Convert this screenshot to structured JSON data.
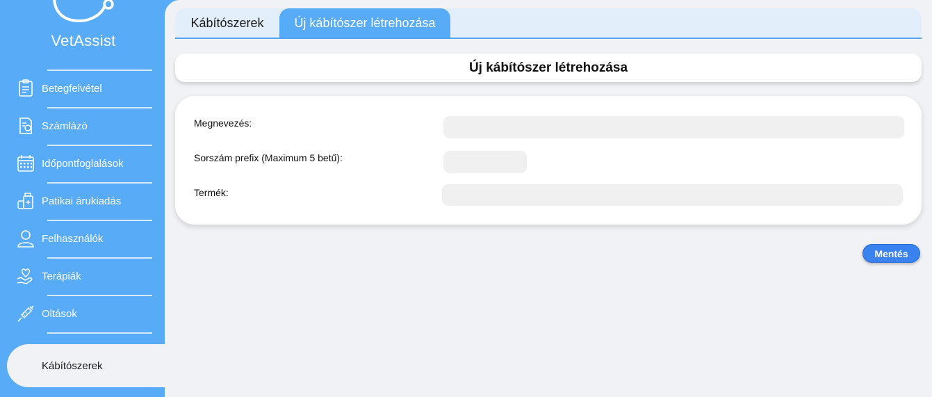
{
  "app": {
    "name": "VetAssist"
  },
  "sidebar": {
    "items": [
      {
        "label": "Betegfelvétel",
        "icon": "patient-file-icon"
      },
      {
        "label": "Számlázó",
        "icon": "invoice-icon"
      },
      {
        "label": "Időpontfoglalások",
        "icon": "calendar-icon"
      },
      {
        "label": "Patikai árukiadás",
        "icon": "pharmacy-bottles-icon"
      },
      {
        "label": "Felhasználók",
        "icon": "user-icon"
      },
      {
        "label": "Terápiák",
        "icon": "heart-hand-icon"
      },
      {
        "label": "Oltások",
        "icon": "syringe-icon"
      },
      {
        "label": "Kábítószerek",
        "icon": "",
        "active": true
      }
    ]
  },
  "tabs": [
    {
      "label": "Kábítószerek",
      "active": false
    },
    {
      "label": "Új kábítószer létrehozása",
      "active": true
    }
  ],
  "page": {
    "title": "Új kábítószer létrehozása"
  },
  "form": {
    "name_label": "Megnevezés:",
    "name_value": "",
    "prefix_label": "Sorszám prefix (Maximum 5 betű):",
    "prefix_value": "",
    "product_label": "Termék:",
    "product_value": ""
  },
  "actions": {
    "save_label": "Mentés"
  },
  "colors": {
    "sidebar": "#58abf6",
    "accent": "#3a82f0",
    "background": "#f1f2f6"
  }
}
